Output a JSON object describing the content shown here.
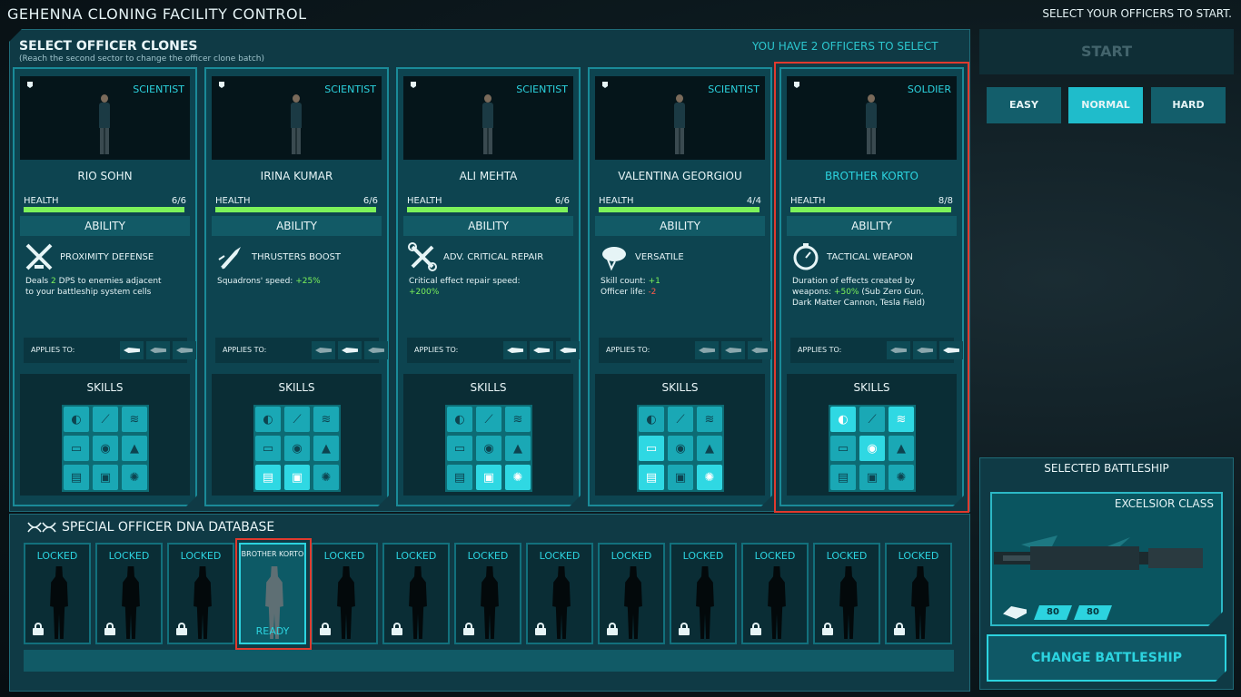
{
  "header": {
    "title": "GEHENNA CLONING FACILITY CONTROL",
    "hint": "SELECT YOUR OFFICERS TO START."
  },
  "officer_panel": {
    "title": "SELECT OFFICER CLONES",
    "subtitle": "(Reach the second sector to change the officer clone batch)",
    "select_count": "YOU HAVE 2 OFFICERS TO SELECT",
    "health_label": "HEALTH",
    "ability_label": "ABILITY",
    "applies_label": "APPLIES TO:",
    "skills_label": "SKILLS"
  },
  "officers": [
    {
      "role": "SCIENTIST",
      "name": "RIO SOHN",
      "health": "6/6",
      "health_fraction": 1.0,
      "ability": "PROXIMITY DEFENSE",
      "desc_parts": [
        [
          "Deals ",
          ""
        ],
        [
          "2",
          "g"
        ],
        [
          " DPS to enemies adjacent\nto your battleship system cells",
          ""
        ]
      ],
      "ability_icon": "crossed-swords-icon",
      "applies": [
        true,
        false,
        false
      ],
      "skills_active": [
        false,
        false,
        false,
        false,
        false,
        false,
        false,
        false,
        false
      ],
      "highlight": false
    },
    {
      "role": "SCIENTIST",
      "name": "IRINA KUMAR",
      "health": "6/6",
      "health_fraction": 1.0,
      "ability": "THRUSTERS BOOST",
      "desc_parts": [
        [
          "Squadrons' speed: ",
          ""
        ],
        [
          "+25%",
          "g"
        ]
      ],
      "ability_icon": "thruster-icon",
      "applies": [
        false,
        true,
        false
      ],
      "skills_active": [
        false,
        false,
        false,
        false,
        false,
        false,
        true,
        true,
        false
      ],
      "highlight": false
    },
    {
      "role": "SCIENTIST",
      "name": "ALI MEHTA",
      "health": "6/6",
      "health_fraction": 1.0,
      "ability": "ADV. CRITICAL REPAIR",
      "desc_parts": [
        [
          "Critical effect repair speed:\n",
          ""
        ],
        [
          "+200%",
          "g"
        ]
      ],
      "ability_icon": "wrench-icon",
      "applies": [
        true,
        true,
        true
      ],
      "skills_active": [
        false,
        false,
        false,
        false,
        false,
        false,
        false,
        true,
        true
      ],
      "highlight": false
    },
    {
      "role": "SCIENTIST",
      "name": "VALENTINA GEORGIOU",
      "health": "4/4",
      "health_fraction": 1.0,
      "ability": "VERSATILE",
      "desc_parts": [
        [
          "Skill count: ",
          ""
        ],
        [
          "+1",
          "g"
        ],
        [
          "\nOfficer life: ",
          ""
        ],
        [
          "-2",
          "r"
        ]
      ],
      "ability_icon": "brain-icon",
      "applies": [
        false,
        false,
        false
      ],
      "skills_active": [
        false,
        false,
        false,
        true,
        false,
        false,
        true,
        false,
        true
      ],
      "highlight": false
    },
    {
      "role": "SOLDIER",
      "name": "BROTHER KORTO",
      "health": "8/8",
      "health_fraction": 1.0,
      "ability": "TACTICAL WEAPON",
      "desc_parts": [
        [
          "Duration of effects created by\nweapons: ",
          ""
        ],
        [
          "+50%",
          "g"
        ],
        [
          " (Sub Zero Gun,\nDark Matter Cannon, Tesla Field)",
          ""
        ]
      ],
      "ability_icon": "stopwatch-icon",
      "applies": [
        false,
        false,
        true
      ],
      "skills_active": [
        true,
        false,
        true,
        false,
        true,
        false,
        false,
        false,
        false
      ],
      "highlight": true
    }
  ],
  "skill_glyphs": [
    "◐",
    "⟋",
    "≋",
    "▭",
    "◉",
    "▲",
    "▤",
    "▣",
    "✺"
  ],
  "skill_names": [
    "helmet-icon",
    "blade-icon",
    "claw-icon",
    "chat-icon",
    "eye-icon",
    "shield-icon",
    "book-icon",
    "chip-icon",
    "gear-icon"
  ],
  "dna": {
    "title": "SPECIAL OFFICER DNA DATABASE",
    "locked_label": "LOCKED",
    "slots": [
      {
        "state": "locked"
      },
      {
        "state": "locked"
      },
      {
        "state": "locked"
      },
      {
        "state": "ready",
        "name": "BROTHER KORTO",
        "status": "READY"
      },
      {
        "state": "locked"
      },
      {
        "state": "locked"
      },
      {
        "state": "locked"
      },
      {
        "state": "locked"
      },
      {
        "state": "locked"
      },
      {
        "state": "locked"
      },
      {
        "state": "locked"
      },
      {
        "state": "locked"
      },
      {
        "state": "locked"
      }
    ]
  },
  "controls": {
    "start": "START",
    "difficulty": [
      {
        "label": "EASY",
        "active": false
      },
      {
        "label": "NORMAL",
        "active": true
      },
      {
        "label": "HARD",
        "active": false
      }
    ]
  },
  "battleship": {
    "title": "SELECTED BATTLESHIP",
    "class": "EXCELSIOR CLASS",
    "stat1": "80",
    "stat2": "80",
    "change": "CHANGE BATTLESHIP"
  },
  "colors": {
    "accent": "#2cd3df",
    "health": "#7cf25a",
    "selection": "#e03a2e"
  }
}
